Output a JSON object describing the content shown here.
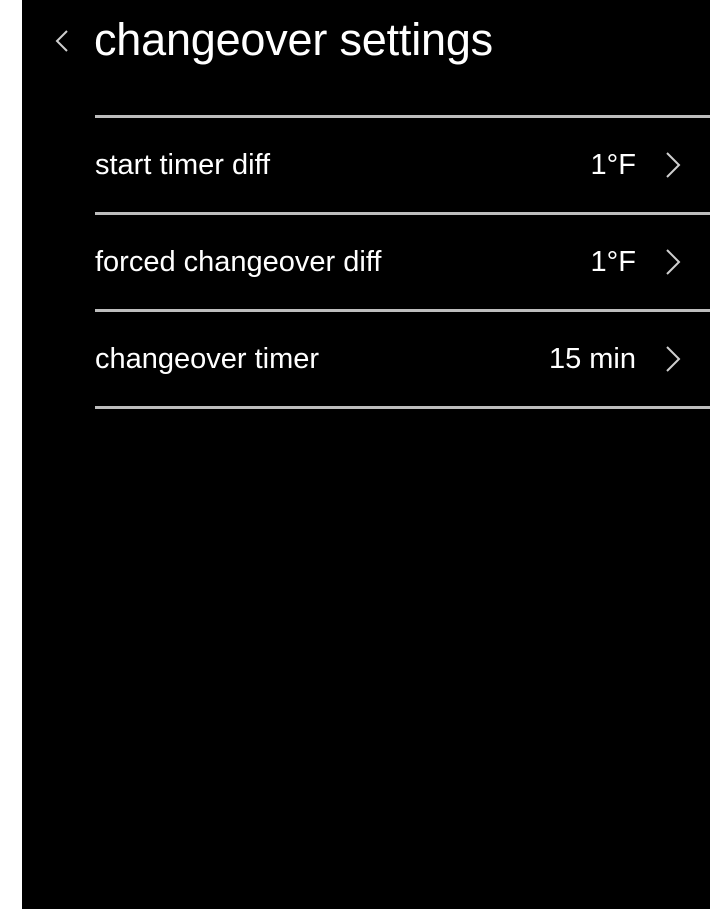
{
  "header": {
    "title": "changeover settings",
    "back_icon": "chevron-left-icon"
  },
  "settings": {
    "items": [
      {
        "label": "start timer diff",
        "value": "1°F",
        "icon": "chevron-right-icon"
      },
      {
        "label": "forced changeover diff",
        "value": "1°F",
        "icon": "chevron-right-icon"
      },
      {
        "label": "changeover timer",
        "value": "15 min",
        "icon": "chevron-right-icon"
      }
    ]
  },
  "colors": {
    "background": "#000000",
    "text": "#ffffff",
    "divider": "#bdbdbd",
    "chevron": "#cfcfcf"
  }
}
